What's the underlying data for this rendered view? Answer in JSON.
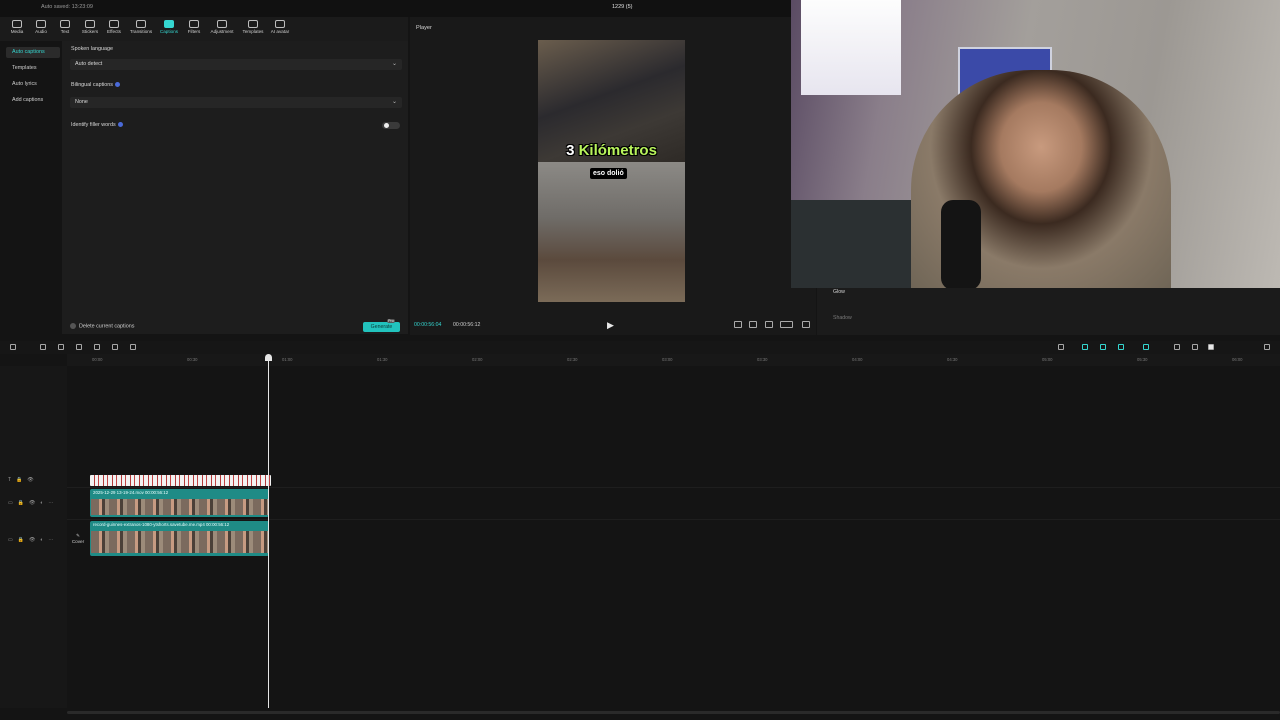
{
  "topbar": {
    "autosave": "Auto saved: 13:23:09",
    "title": "1229 (5)"
  },
  "toolbar": {
    "tools": [
      {
        "label": "Media",
        "active": false
      },
      {
        "label": "Audio",
        "active": false
      },
      {
        "label": "Text",
        "active": false
      },
      {
        "label": "Stickers",
        "active": false
      },
      {
        "label": "Effects",
        "active": false
      },
      {
        "label": "Transitions",
        "active": false
      },
      {
        "label": "Captions",
        "active": true
      },
      {
        "label": "Filters",
        "active": false
      },
      {
        "label": "Adjustment",
        "active": false
      },
      {
        "label": "Templates",
        "active": false
      },
      {
        "label": "AI avatar",
        "active": false
      }
    ]
  },
  "leftnav": {
    "items": [
      {
        "label": "Auto captions",
        "active": true
      },
      {
        "label": "Templates",
        "active": false
      },
      {
        "label": "Auto lyrics",
        "active": false
      },
      {
        "label": "Add captions",
        "active": false
      }
    ]
  },
  "captions_panel": {
    "spoken_language_label": "Spoken language",
    "spoken_language_value": "Auto detect",
    "bilingual_label": "Bilingual captions",
    "bilingual_value": "None",
    "filler_label": "Identify filler words",
    "delete_label": "Delete current captions",
    "generate_label": "Generate",
    "pro_badge": "Pro"
  },
  "player": {
    "label": "Player",
    "headline_number": "3",
    "headline_word": "Kilómetros",
    "subtitle": "eso dolió",
    "current_time": "00:00:56:04",
    "total_time": "00:00:56:12"
  },
  "properties": {
    "glow_label": "Glow",
    "shadow_label": "Shadow"
  },
  "timeline": {
    "ticks": [
      "00:00",
      "00:30",
      "01:00",
      "01:30",
      "02:00",
      "02:30",
      "03:00",
      "03:30",
      "04:00",
      "04:30",
      "05:00",
      "05:30",
      "06:00"
    ],
    "clip1_label": "2025-12-29 13-19-24.mov  00:00:56:12",
    "clip2_label": "record-guinnes-extranos-1080-ytshorts.savetube.me.mp4  00:00:56:12",
    "cover_label": "Cover"
  },
  "colors": {
    "accent": "#35d6d0",
    "clip": "#1f8b86"
  }
}
